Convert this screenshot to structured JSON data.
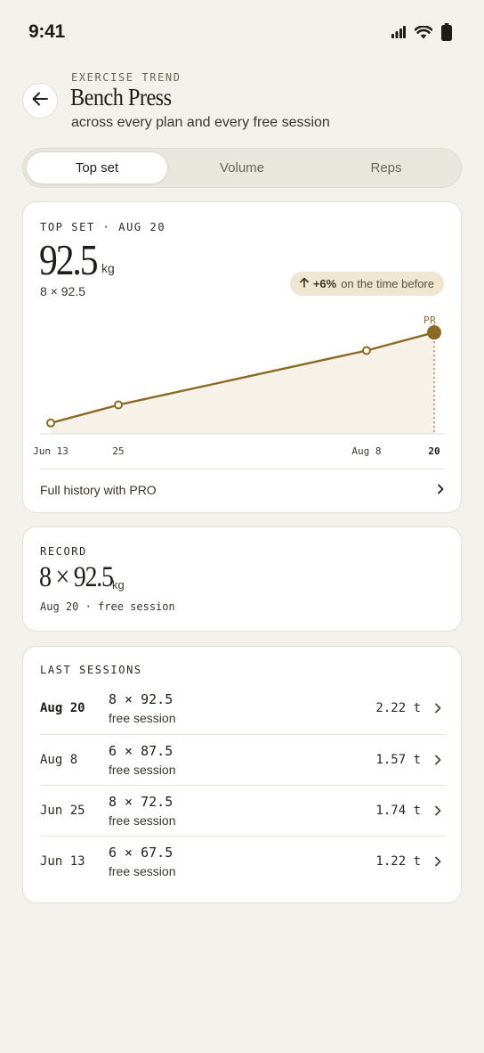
{
  "status_bar": {
    "time": "9:41",
    "icons": [
      "signal-icon",
      "wifi-icon",
      "battery-icon"
    ]
  },
  "header": {
    "eyebrow": "EXERCISE TREND",
    "title": "Bench Press",
    "subtitle": "across every plan and every free session"
  },
  "tabs": [
    {
      "label": "Top set",
      "active": true
    },
    {
      "label": "Volume",
      "active": false
    },
    {
      "label": "Reps",
      "active": false
    }
  ],
  "topset": {
    "label": "TOP SET · AUG 20",
    "value": "92.5",
    "unit": "kg",
    "detail": "8 × 92.5",
    "change_value": "+6%",
    "change_text": "on the time before",
    "history_link": "Full history with PRO"
  },
  "chart_data": {
    "type": "line",
    "x": [
      "Jun 13",
      "Jun 25",
      "Aug 8",
      "Aug 20"
    ],
    "tick_labels": [
      "Jun 13",
      "25",
      "Aug 8",
      "20"
    ],
    "values": [
      67.5,
      72.5,
      87.5,
      92.5
    ],
    "pr_label": "PR",
    "accent_color": "#8a6a24"
  },
  "record": {
    "label": "RECORD",
    "value": "8 × 92.5",
    "unit": "kg",
    "meta": "Aug 20 · free session"
  },
  "sessions": {
    "label": "LAST SESSIONS",
    "rows": [
      {
        "date": "Aug 20",
        "set": "8 × 92.5",
        "type": "free session",
        "volume": "2.22 t",
        "bold": true
      },
      {
        "date": "Aug 8",
        "set": "6 × 87.5",
        "type": "free session",
        "volume": "1.57 t",
        "bold": false
      },
      {
        "date": "Jun 25",
        "set": "8 × 72.5",
        "type": "free session",
        "volume": "1.74 t",
        "bold": false
      },
      {
        "date": "Jun 13",
        "set": "6 × 67.5",
        "type": "free session",
        "volume": "1.22 t",
        "bold": false
      }
    ]
  }
}
